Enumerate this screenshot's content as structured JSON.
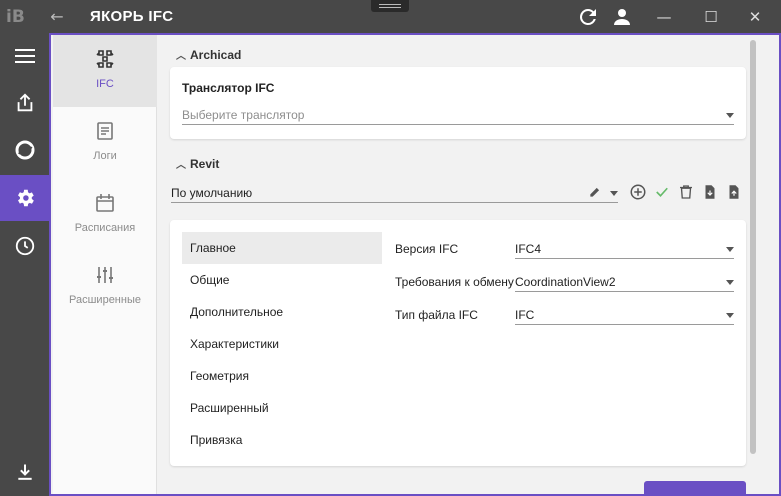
{
  "titlebar": {
    "logo_text": "iB",
    "title": "ЯКОРЬ IFC",
    "back_arrow": "←",
    "minimize": "—",
    "maximize": "☐",
    "close": "✕"
  },
  "rail": {
    "items": [
      {
        "icon": "menu-icon"
      },
      {
        "icon": "share-icon"
      },
      {
        "icon": "ring-icon"
      },
      {
        "icon": "gear-icon",
        "active": true
      },
      {
        "icon": "clock-icon"
      }
    ],
    "bottom_icon": "download-icon"
  },
  "sidetabs": [
    {
      "label": "IFC",
      "icon": "ifc-icon",
      "active": true
    },
    {
      "label": "Логи",
      "icon": "document-icon"
    },
    {
      "label": "Расписания",
      "icon": "calendar-icon"
    },
    {
      "label": "Расширенные",
      "icon": "sliders-icon"
    }
  ],
  "archicad": {
    "section": "Archicad",
    "translator_title": "Транслятор IFC",
    "translator_placeholder": "Выберите транслятор"
  },
  "revit": {
    "section": "Revit",
    "preset_value": "По умолчанию",
    "menu": [
      "Главное",
      "Общие",
      "Дополнительное",
      "Характеристики",
      "Геометрия",
      "Расширенный",
      "Привязка"
    ],
    "props": [
      {
        "label": "Версия IFC",
        "value": "IFC4"
      },
      {
        "label": "Требования к обмену",
        "value": "CoordinationView2"
      },
      {
        "label": "Тип файла IFC",
        "value": "IFC"
      }
    ]
  },
  "colors": {
    "accent": "#6a4fc4",
    "rail": "#484848",
    "check": "#66bb6a"
  }
}
